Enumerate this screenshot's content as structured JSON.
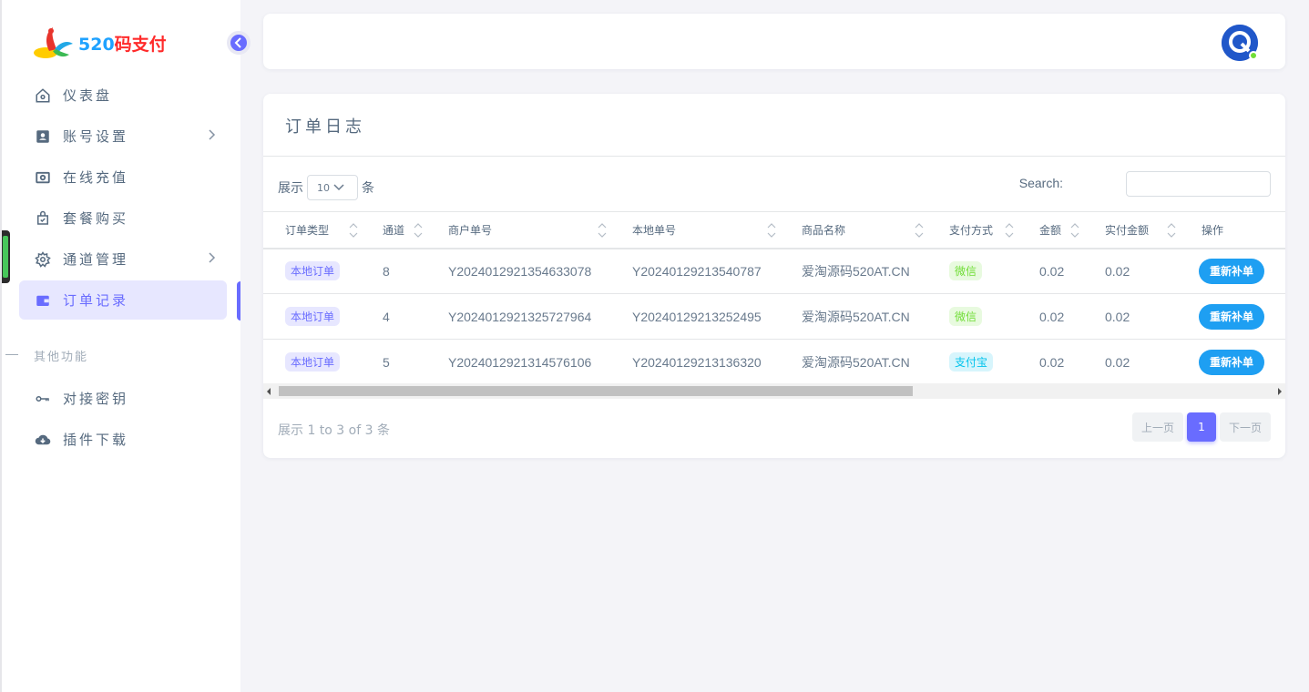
{
  "brand": {
    "digits": "520",
    "chars": "码支付"
  },
  "sidebar": {
    "items": [
      {
        "label": "仪表盘",
        "icon": "home-icon"
      },
      {
        "label": "账号设置",
        "icon": "contact-card-icon",
        "has_submenu": true
      },
      {
        "label": "在线充值",
        "icon": "camera-icon"
      },
      {
        "label": "套餐购买",
        "icon": "shopping-bag-icon"
      },
      {
        "label": "通道管理",
        "icon": "gear-icon",
        "has_submenu": true
      },
      {
        "label": "订单记录",
        "icon": "wallet-icon",
        "active": true
      }
    ],
    "section_header": "其他功能",
    "items2": [
      {
        "label": "对接密钥",
        "icon": "key-icon"
      },
      {
        "label": "插件下载",
        "icon": "cloud-download-icon"
      }
    ]
  },
  "card": {
    "title": "订单日志",
    "length": {
      "prefix": "展示",
      "value": "10",
      "suffix": "条"
    },
    "search_label": "Search:",
    "search_value": "",
    "columns": [
      "订单类型",
      "通道",
      "商户单号",
      "本地单号",
      "商品名称",
      "支付方式",
      "金额",
      "实付金额",
      "操作"
    ],
    "rows": [
      {
        "type": "本地订单",
        "channel": "8",
        "merchant_no": "Y2024012921354633078",
        "local_no": "Y20240129213540787",
        "product": "爱淘源码520AT.CN",
        "pay": "微信",
        "pay_kind": "wx",
        "amount": "0.02",
        "paid": "0.02",
        "action": "重新补单"
      },
      {
        "type": "本地订单",
        "channel": "4",
        "merchant_no": "Y2024012921325727964",
        "local_no": "Y20240129213252495",
        "product": "爱淘源码520AT.CN",
        "pay": "微信",
        "pay_kind": "wx",
        "amount": "0.02",
        "paid": "0.02",
        "action": "重新补单"
      },
      {
        "type": "本地订单",
        "channel": "5",
        "merchant_no": "Y2024012921314576106",
        "local_no": "Y20240129213136320",
        "product": "爱淘源码520AT.CN",
        "pay": "支付宝",
        "pay_kind": "ali",
        "amount": "0.02",
        "paid": "0.02",
        "action": "重新补单"
      }
    ],
    "info": "展示 1 to 3 of 3 条",
    "pager": {
      "prev": "上一页",
      "current": "1",
      "next": "下一页"
    }
  },
  "colors": {
    "primary": "#696cff",
    "resend_button": "#1e9ff2",
    "wechat": "#71dd37",
    "alipay": "#03c3ec"
  }
}
